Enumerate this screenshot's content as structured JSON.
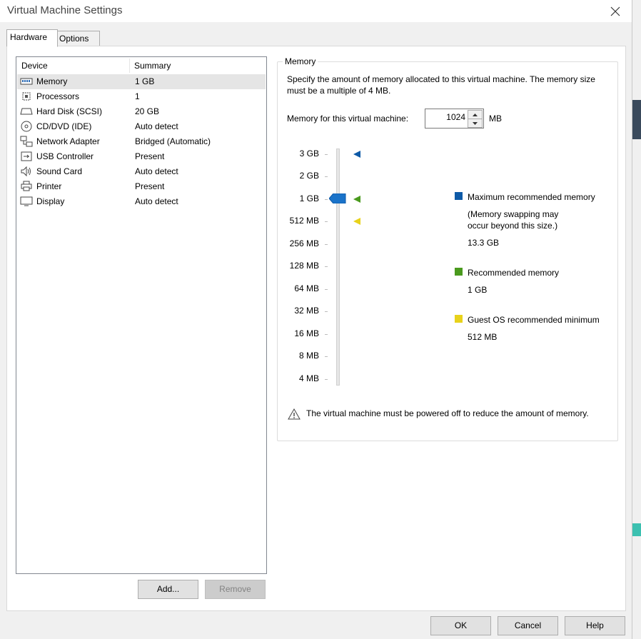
{
  "window": {
    "title": "Virtual Machine Settings"
  },
  "tabs": [
    {
      "label": "Hardware"
    },
    {
      "label": "Options"
    }
  ],
  "device_list": {
    "headers": {
      "device": "Device",
      "summary": "Summary"
    },
    "rows": [
      {
        "name": "Memory",
        "summary": "1 GB",
        "icon": "memory-icon"
      },
      {
        "name": "Processors",
        "summary": "1",
        "icon": "processor-icon"
      },
      {
        "name": "Hard Disk (SCSI)",
        "summary": "20 GB",
        "icon": "hard-disk-icon"
      },
      {
        "name": "CD/DVD (IDE)",
        "summary": "Auto detect",
        "icon": "cd-dvd-icon"
      },
      {
        "name": "Network Adapter",
        "summary": "Bridged (Automatic)",
        "icon": "network-adapter-icon"
      },
      {
        "name": "USB Controller",
        "summary": "Present",
        "icon": "usb-icon"
      },
      {
        "name": "Sound Card",
        "summary": "Auto detect",
        "icon": "speaker-icon"
      },
      {
        "name": "Printer",
        "summary": "Present",
        "icon": "printer-icon"
      },
      {
        "name": "Display",
        "summary": "Auto detect",
        "icon": "display-icon"
      }
    ]
  },
  "buttons": {
    "add": "Add...",
    "remove": "Remove",
    "ok": "OK",
    "cancel": "Cancel",
    "help": "Help"
  },
  "memory": {
    "group_title": "Memory",
    "description": "Specify the amount of memory allocated to this virtual machine. The memory size must be a multiple of 4 MB.",
    "field_label": "Memory for this virtual machine:",
    "value": "1024",
    "unit": "MB",
    "scale": [
      "3 GB",
      "2 GB",
      "1 GB",
      "512 MB",
      "256 MB",
      "128 MB",
      "64 MB",
      "32 MB",
      "16 MB",
      "8 MB",
      "4 MB"
    ],
    "legend": {
      "max": {
        "title": "Maximum recommended memory",
        "note": "(Memory swapping may occur beyond this size.)",
        "value": "13.3 GB",
        "color": "#0e5aa7"
      },
      "recommended": {
        "title": "Recommended memory",
        "value": "1 GB",
        "color": "#4a9a1e"
      },
      "guest_min": {
        "title": "Guest OS recommended minimum",
        "value": "512 MB",
        "color": "#e8d21b"
      }
    },
    "warning": "The virtual machine must be powered off to reduce the amount of memory."
  }
}
